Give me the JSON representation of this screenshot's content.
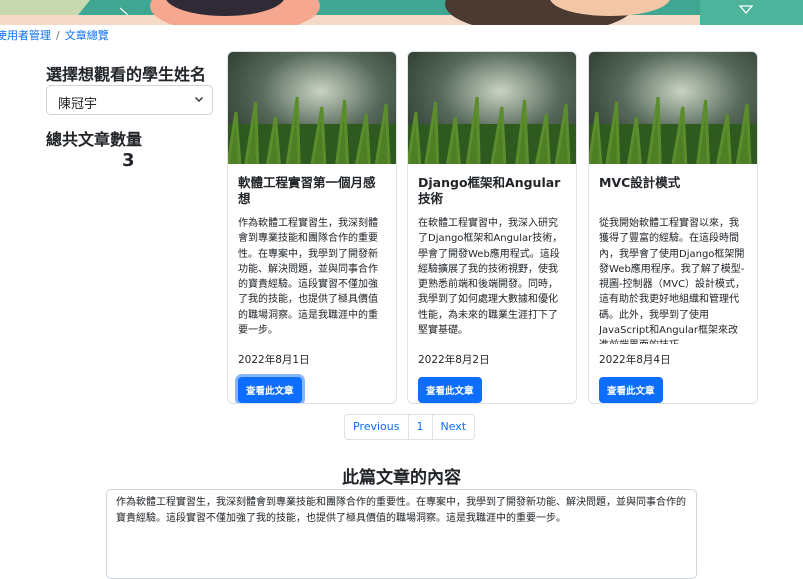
{
  "breadcrumb": {
    "items": [
      "使用者管理",
      "文章總覽"
    ],
    "separator": "/"
  },
  "student_select": {
    "label": "選擇想觀看的學生姓名",
    "value": "陳冠宇"
  },
  "article_count": {
    "label": "總共文章數量",
    "value": "3"
  },
  "articles": [
    {
      "title": "軟體工程實習第一個月感想",
      "text": "作為軟體工程實習生，我深刻體會到專業技能和團隊合作的重要性。在專案中，我學到了開發新功能、解決問題，並與同事合作的寶貴經驗。這段實習不僅加強了我的技能，也提供了極具價值的職場洞察。這是我職涯中的重要一步。",
      "date": "2022年8月1日",
      "button": "查看此文章"
    },
    {
      "title": "Django框架和Angular技術",
      "text": "在軟體工程實習中，我深入研究了Django框架和Angular技術，學會了開發Web應用程式。這段經驗擴展了我的技術視野，使我更熟悉前端和後端開發。同時，我學到了如何處理大數據和優化性能，為未來的職業生涯打下了堅實基礎。",
      "date": "2022年8月2日",
      "button": "查看此文章"
    },
    {
      "title": "MVC設計模式",
      "text": "從我開始軟體工程實習以來，我獲得了豐富的經驗。在這段時間內，我學會了使用Django框架開發Web應用程序。我了解了模型-視圖-控制器（MVC）設計模式，這有助於我更好地組織和管理代碼。此外，我學到了使用JavaScript和Angular框架來改進前端界面的技巧。",
      "date": "2022年8月4日",
      "button": "查看此文章"
    }
  ],
  "pagination": {
    "prev": "Previous",
    "page": "1",
    "next": "Next"
  },
  "content": {
    "heading": "此篇文章的內容",
    "body": "作為軟體工程實習生，我深刻體會到專業技能和團隊合作的重要性。在專案中，我學到了開發新功能、解決問題，並與同事合作的寶貴經驗。這段實習不僅加強了我的技能，也提供了極具價值的職場洞察。這是我職涯中的重要一步。"
  },
  "icons": {
    "select_arrow": "chevron-down-icon"
  },
  "colors": {
    "primary": "#0d6efd",
    "banner": "#3fa791"
  }
}
